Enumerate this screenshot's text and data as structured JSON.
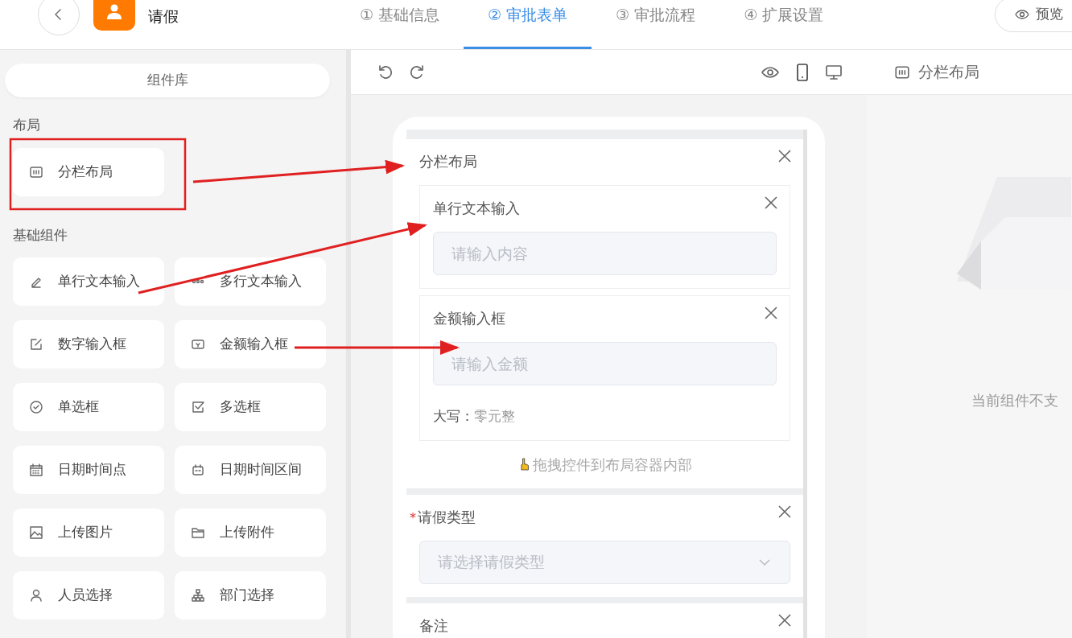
{
  "header": {
    "title": "请假",
    "preview_button": "预览",
    "tabs": [
      {
        "number": "①",
        "label": "基础信息",
        "selected": false
      },
      {
        "number": "②",
        "label": "审批表单",
        "selected": true
      },
      {
        "number": "③",
        "label": "审批流程",
        "selected": false
      },
      {
        "number": "④",
        "label": "扩展设置",
        "selected": false
      }
    ]
  },
  "library": {
    "title": "组件库",
    "groups": [
      {
        "title": "布局",
        "items": [
          {
            "label": "分栏布局"
          }
        ]
      },
      {
        "title": "基础组件",
        "items": [
          {
            "label": "单行文本输入"
          },
          {
            "label": "多行文本输入"
          },
          {
            "label": "数字输入框"
          },
          {
            "label": "金额输入框"
          },
          {
            "label": "单选框"
          },
          {
            "label": "多选框"
          },
          {
            "label": "日期时间点"
          },
          {
            "label": "日期时间区间"
          },
          {
            "label": "上传图片"
          },
          {
            "label": "上传附件"
          },
          {
            "label": "人员选择"
          },
          {
            "label": "部门选择"
          }
        ]
      }
    ]
  },
  "canvas": {
    "fields": [
      {
        "kind": "layout",
        "label": "分栏布局",
        "drop_hint": "拖拽控件到布局容器内部",
        "children": [
          {
            "kind": "text",
            "label": "单行文本输入",
            "placeholder": "请输入内容"
          },
          {
            "kind": "money",
            "label": "金额输入框",
            "placeholder": "请输入金额",
            "caption_label": "大写：",
            "caption_value": "零元整"
          }
        ]
      },
      {
        "kind": "select",
        "label": "请假类型",
        "required": true,
        "required_mark": "*",
        "placeholder": "请选择请假类型"
      },
      {
        "kind": "textarea",
        "label": "备注",
        "required": false
      }
    ]
  },
  "properties": {
    "title": "分栏布局",
    "message": "当前组件不支"
  }
}
